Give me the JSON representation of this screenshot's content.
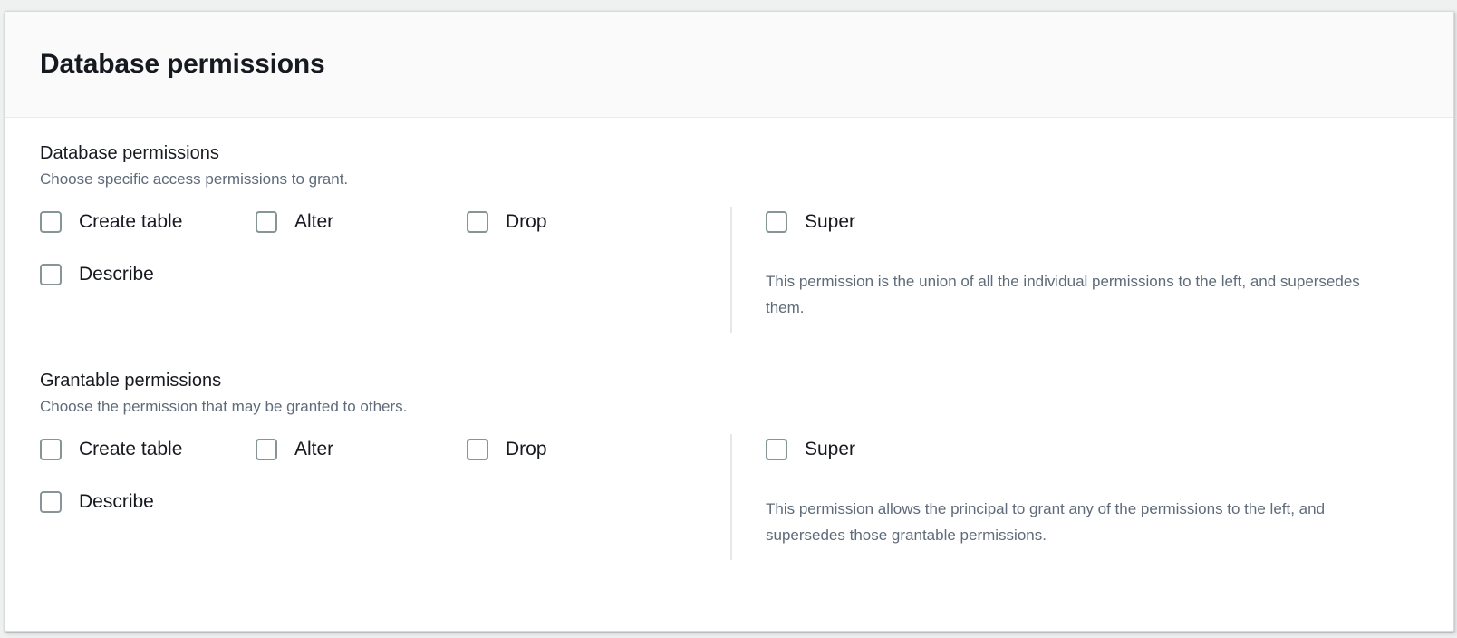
{
  "card": {
    "title": "Database permissions"
  },
  "sections": [
    {
      "heading": "Database permissions",
      "subheading": "Choose specific access permissions to grant.",
      "left_checkboxes": [
        {
          "label": "Create table",
          "checked": false
        },
        {
          "label": "Alter",
          "checked": false
        },
        {
          "label": "Drop",
          "checked": false
        },
        {
          "label": "Describe",
          "checked": false
        }
      ],
      "right_checkbox": {
        "label": "Super",
        "checked": false
      },
      "right_help": "This permission is the union of all the individual permissions to the left, and supersedes them."
    },
    {
      "heading": "Grantable permissions",
      "subheading": "Choose the permission that may be granted to others.",
      "left_checkboxes": [
        {
          "label": "Create table",
          "checked": false
        },
        {
          "label": "Alter",
          "checked": false
        },
        {
          "label": "Drop",
          "checked": false
        },
        {
          "label": "Describe",
          "checked": false
        }
      ],
      "right_checkbox": {
        "label": "Super",
        "checked": false
      },
      "right_help": "This permission allows the principal to grant any of the permissions to the left, and supersedes those grantable permissions."
    }
  ],
  "colors": {
    "page_background": "#eff0f0",
    "card_background": "#ffffff",
    "header_background": "#fafafa",
    "border": "#d5dbdb",
    "divider": "#e5e8ea",
    "text_primary": "#16191f",
    "text_secondary": "#5f6b7a",
    "checkbox_border": "#879596"
  }
}
